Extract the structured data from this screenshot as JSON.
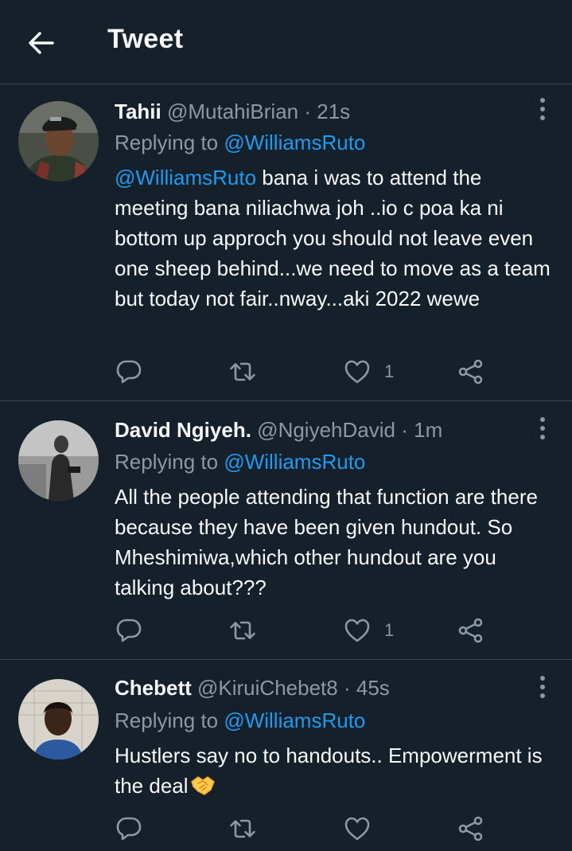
{
  "header": {
    "title": "Tweet"
  },
  "tweets": [
    {
      "name": "Tahii",
      "handle": "@MutahiBrian",
      "dot": "·",
      "time": "21s",
      "replying_prefix": "Replying to",
      "replying_to": "@WilliamsRuto",
      "mention": "@WilliamsRuto",
      "text": " bana i was to attend the meeting bana niliachwa joh ..io c poa ka ni bottom up approch you should not leave even one sheep behind...we need to move as a team but today not fair..nway...aki 2022 wewe",
      "likes": "1"
    },
    {
      "name": "David Ngiyeh.",
      "handle": "@NgiyehDavid",
      "dot": "·",
      "time": "1m",
      "replying_prefix": "Replying to",
      "replying_to": "@WilliamsRuto",
      "text": "All the people attending that function are there because they have been given hundout. So Mheshimiwa,which other hundout are you talking about???",
      "likes": "1"
    },
    {
      "name": "Chebett",
      "handle": "@KiruiChebet8",
      "dot": "·",
      "time": "45s",
      "replying_prefix": "Replying to",
      "replying_to": "@WilliamsRuto",
      "text": "Hustlers say no to handouts.. Empowerment is the deal",
      "emoji": "handshake-emoji",
      "likes": ""
    }
  ],
  "icons": {
    "back": "arrow-left-icon",
    "more": "more-vertical-icon",
    "reply": "reply-icon",
    "retweet": "retweet-icon",
    "like": "heart-icon",
    "share": "share-icon"
  },
  "colors": {
    "background": "#15202b",
    "divider": "#38444d",
    "text": "#f7f9f9",
    "secondary": "#8b98a5",
    "link": "#1d9bf0"
  }
}
